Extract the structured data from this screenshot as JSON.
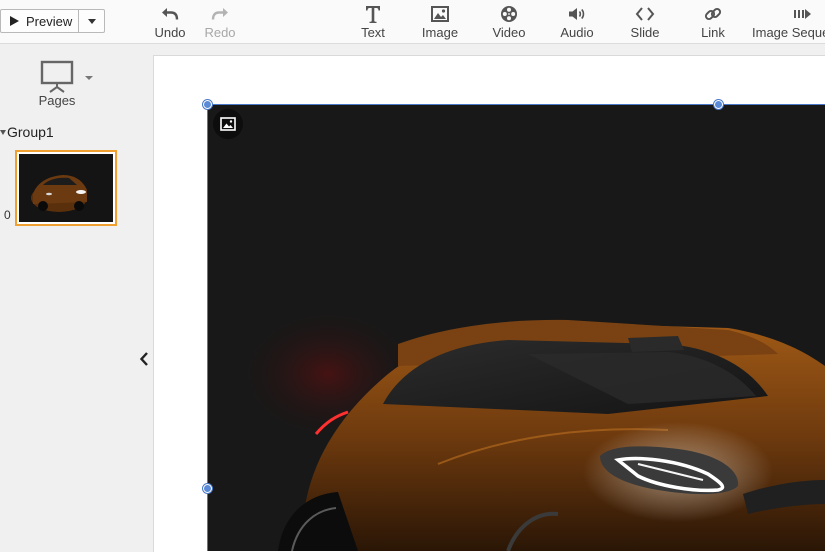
{
  "toolbar": {
    "preview_label": "Preview",
    "undo_label": "Undo",
    "redo_label": "Redo",
    "text_label": "Text",
    "image_label": "Image",
    "video_label": "Video",
    "audio_label": "Audio",
    "slide_label": "Slide",
    "link_label": "Link",
    "image_sequence_label": "Image Seque"
  },
  "sidebar": {
    "pages_label": "Pages",
    "group_title": "Group1",
    "page_number": "0"
  },
  "colors": {
    "accent_selection": "#4a78c8",
    "thumb_border": "#f0a030",
    "car_body": "#8a4a12"
  },
  "icons": {
    "preview": "play-icon",
    "dropdown": "chevron-down-icon",
    "undo": "undo-icon",
    "redo": "redo-icon",
    "text": "text-icon",
    "image": "image-icon",
    "video": "film-reel-icon",
    "audio": "speaker-icon",
    "slide": "code-brackets-icon",
    "link": "link-icon",
    "image_sequence": "image-sequence-icon",
    "pages": "presentation-screen-icon",
    "collapse": "chevron-left-icon",
    "image_badge": "image-icon"
  }
}
